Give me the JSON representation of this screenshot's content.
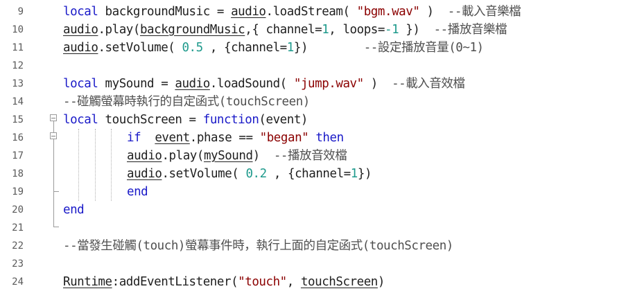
{
  "editor": {
    "lines": [
      {
        "num": "9",
        "tokens": [
          [
            "kw",
            "local"
          ],
          [
            "t",
            " backgroundMusic = "
          ],
          [
            "ul",
            "audio"
          ],
          [
            "t",
            ".loadStream( "
          ],
          [
            "str",
            "\"bgm.wav\""
          ],
          [
            "t",
            " )  "
          ],
          [
            "cmt",
            "--載入音樂檔"
          ]
        ]
      },
      {
        "num": "10",
        "tokens": [
          [
            "ul",
            "audio"
          ],
          [
            "t",
            ".play("
          ],
          [
            "ul",
            "backgroundMusic"
          ],
          [
            "t",
            ",{ channel="
          ],
          [
            "num",
            "1"
          ],
          [
            "t",
            ", loops="
          ],
          [
            "num",
            "-1"
          ],
          [
            "t",
            " })  "
          ],
          [
            "cmt",
            "--播放音樂檔"
          ]
        ]
      },
      {
        "num": "11",
        "tokens": [
          [
            "ul",
            "audio"
          ],
          [
            "t",
            ".setVolume( "
          ],
          [
            "num",
            "0.5"
          ],
          [
            "t",
            " , {channel="
          ],
          [
            "num",
            "1"
          ],
          [
            "t",
            "})        "
          ],
          [
            "cmt",
            "--設定播放音量(0~1)"
          ]
        ]
      },
      {
        "num": "12",
        "tokens": []
      },
      {
        "num": "13",
        "tokens": [
          [
            "kw",
            "local"
          ],
          [
            "t",
            " mySound = "
          ],
          [
            "ul",
            "audio"
          ],
          [
            "t",
            ".loadSound( "
          ],
          [
            "str",
            "\"jump.wav\""
          ],
          [
            "t",
            " )  "
          ],
          [
            "cmt",
            "--載入音效檔"
          ]
        ]
      },
      {
        "num": "14",
        "tokens": [
          [
            "cmt",
            "--碰觸螢幕時執行的自定函式(touchScreen)"
          ]
        ]
      },
      {
        "num": "15",
        "tokens": [
          [
            "kw",
            "local"
          ],
          [
            "t",
            " touchScreen = "
          ],
          [
            "kw",
            "function"
          ],
          [
            "t",
            "(event)"
          ]
        ]
      },
      {
        "num": "16",
        "tokens": [
          [
            "kw",
            "if"
          ],
          [
            "t",
            "  "
          ],
          [
            "ul",
            "event"
          ],
          [
            "t",
            ".phase == "
          ],
          [
            "str",
            "\"began\""
          ],
          [
            "t",
            " "
          ],
          [
            "kw",
            "then"
          ]
        ]
      },
      {
        "num": "17",
        "tokens": [
          [
            "ul",
            "audio"
          ],
          [
            "t",
            ".play("
          ],
          [
            "ul",
            "mySound"
          ],
          [
            "t",
            ")  "
          ],
          [
            "cmt",
            "--播放音效檔"
          ]
        ]
      },
      {
        "num": "18",
        "tokens": [
          [
            "ul",
            "audio"
          ],
          [
            "t",
            ".setVolume( "
          ],
          [
            "num",
            "0.2"
          ],
          [
            "t",
            " , {channel="
          ],
          [
            "num",
            "1"
          ],
          [
            "t",
            "})"
          ]
        ]
      },
      {
        "num": "19",
        "tokens": [
          [
            "kw",
            "end"
          ]
        ]
      },
      {
        "num": "20",
        "tokens": [
          [
            "kw",
            "end"
          ]
        ]
      },
      {
        "num": "21",
        "tokens": []
      },
      {
        "num": "22",
        "tokens": [
          [
            "cmt",
            "--當發生碰觸(touch)螢幕事件時，執行上面的自定函式(touchScreen)"
          ]
        ]
      },
      {
        "num": "23",
        "tokens": []
      },
      {
        "num": "24",
        "tokens": [
          [
            "ul",
            "Runtime"
          ],
          [
            "t",
            ":addEventListener("
          ],
          [
            "str",
            "\"touch\""
          ],
          [
            "t",
            ", "
          ],
          [
            "ul",
            "touchScreen"
          ],
          [
            "t",
            ")"
          ]
        ]
      }
    ],
    "colors": {
      "keyword": "#1a1ac8",
      "string": "#8b0000",
      "number": "#1e9a8c",
      "comment": "#4f4f4f",
      "text": "#202020",
      "line_number": "#5a5a5a"
    }
  }
}
